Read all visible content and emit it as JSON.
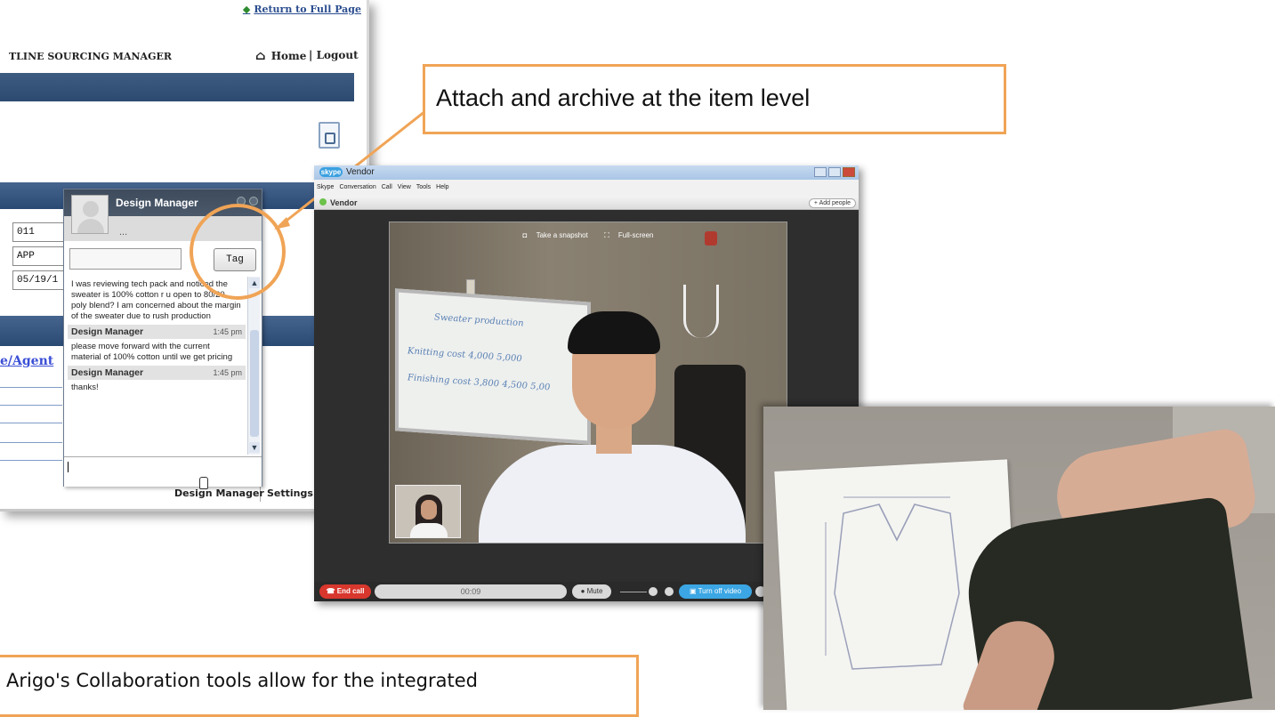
{
  "webapp": {
    "return_link": "Return to Full Page",
    "app_title": "TLINE SOURCING MANAGER",
    "home": "Home",
    "separator": "|",
    "logout": "Logout",
    "fields": [
      "011",
      "APP",
      "05/19/1"
    ],
    "agent_link": "e/Agent",
    "tabs": [
      "Design Manager",
      "Settings"
    ]
  },
  "chat": {
    "title": "Design Manager",
    "status": "...",
    "tag_button": "Tag",
    "first_message": "I was reviewing tech pack and noticed the sweater is 100% cotton r u open to 80/20 poly blend? I am concerned about the margin of the sweater due to rush production",
    "messages": [
      {
        "sender": "Design Manager",
        "time": "1:45 pm",
        "text": "please move forward with the current material of 100% cotton until we get pricing"
      },
      {
        "sender": "Design Manager",
        "time": "1:45 pm",
        "text": "thanks!"
      }
    ]
  },
  "callout": {
    "text": "Attach and archive at the item level",
    "color": "#f0a456"
  },
  "skype": {
    "title": "Vendor",
    "logo": "skype",
    "menu": [
      "Skype",
      "Conversation",
      "Call",
      "View",
      "Tools",
      "Help"
    ],
    "conversation": "Vendor",
    "add_people": "+ Add people",
    "snapshot": "Take a snapshot",
    "fullscreen": "Full-screen",
    "end_call": "End call",
    "timer": "00:09",
    "mute": "Mute",
    "turn_off_video": "Turn off video",
    "whiteboard_lines": [
      "Sweater production",
      "Knitting cost  4,000  5,000",
      "Finishing cost  3,800  4,500  5,00"
    ]
  },
  "caption": {
    "text": "Arigo's Collaboration tools allow for the integrated"
  }
}
